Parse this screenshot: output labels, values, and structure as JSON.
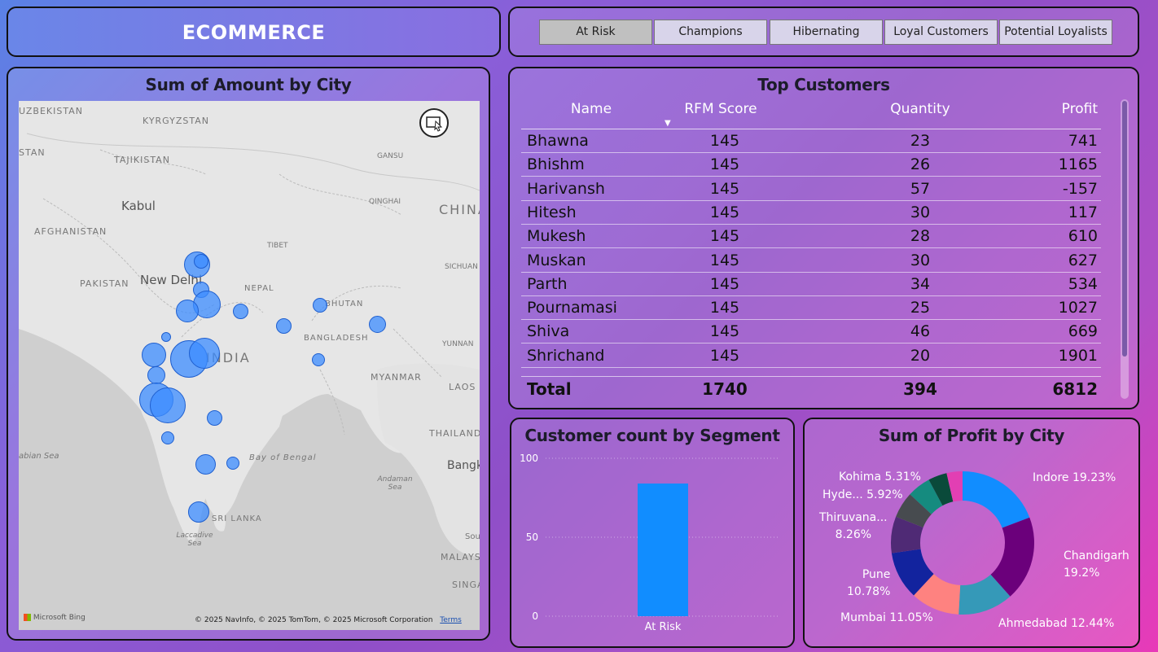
{
  "header": {
    "title": "ECOMMERCE"
  },
  "segments": [
    "At Risk",
    "Champions",
    "Hibernating",
    "Loyal Customers",
    "Potential Loyalists"
  ],
  "selected_segment": "At Risk",
  "map": {
    "title": "Sum of Amount by City",
    "labels": [
      "UZBEKISTAN",
      "KYRGYZSTAN",
      "STAN",
      "TAJIKISTAN",
      "GANSU",
      "Kabul",
      "AFGHANISTAN",
      "QINGHAI",
      "CHINA",
      "TIBET",
      "SICHUAN",
      "PAKISTAN",
      "New Delhi",
      "NEPAL",
      "BHUTAN",
      "BANGLADESH",
      "INDIA",
      "YUNNAN",
      "MYANMAR",
      "LAOS",
      "THAILAND",
      "abian Sea",
      "Bay of Bengal",
      "Bangk",
      "Andaman Sea",
      "SRI LANKA",
      "Laccadive Sea",
      "MALAYS",
      "SINGA",
      "Sou"
    ],
    "attribution": "© 2025 NavInfo, © 2025 TomTom, © 2025 Microsoft Corporation",
    "terms": "Terms",
    "bing": "Microsoft Bing"
  },
  "table": {
    "title": "Top Customers",
    "headers": {
      "name": "Name",
      "rfm": "RFM Score",
      "qty": "Quantity",
      "profit": "Profit"
    },
    "rows": [
      {
        "name": "Bhawna",
        "rfm": "145",
        "qty": "23",
        "profit": "741"
      },
      {
        "name": "Bhishm",
        "rfm": "145",
        "qty": "26",
        "profit": "1165"
      },
      {
        "name": "Harivansh",
        "rfm": "145",
        "qty": "57",
        "profit": "-157"
      },
      {
        "name": "Hitesh",
        "rfm": "145",
        "qty": "30",
        "profit": "117"
      },
      {
        "name": "Mukesh",
        "rfm": "145",
        "qty": "28",
        "profit": "610"
      },
      {
        "name": "Muskan",
        "rfm": "145",
        "qty": "30",
        "profit": "627"
      },
      {
        "name": "Parth",
        "rfm": "145",
        "qty": "34",
        "profit": "534"
      },
      {
        "name": "Pournamasi",
        "rfm": "145",
        "qty": "25",
        "profit": "1027"
      },
      {
        "name": "Shiva",
        "rfm": "145",
        "qty": "46",
        "profit": "669"
      },
      {
        "name": "Shrichand",
        "rfm": "145",
        "qty": "20",
        "profit": "1901"
      }
    ],
    "total": {
      "name": "Total",
      "rfm": "1740",
      "qty": "394",
      "profit": "6812"
    }
  },
  "chart_data": [
    {
      "type": "bar",
      "title": "Customer count by Segment",
      "categories": [
        "At Risk"
      ],
      "values": [
        84
      ],
      "ylim": [
        0,
        100
      ],
      "yticks": [
        "0",
        "50",
        "100"
      ],
      "color": "#118dff"
    },
    {
      "type": "pie",
      "title": "Sum of Profit by City",
      "donut": true,
      "slices": [
        {
          "label": "Indore",
          "value": 19.23,
          "text": "Indore 19.23%",
          "color": "#118dff"
        },
        {
          "label": "Chandigarh",
          "value": 19.2,
          "text": "Chandigarh\n19.2%",
          "color": "#6b007b"
        },
        {
          "label": "Ahmedabad",
          "value": 12.44,
          "text": "Ahmedabad 12.44%",
          "color": "#3599b8"
        },
        {
          "label": "Mumbai",
          "value": 11.05,
          "text": "Mumbai 11.05%",
          "color": "#fe8280"
        },
        {
          "label": "Pune",
          "value": 10.78,
          "text": "Pune\n10.78%",
          "color": "#12239e"
        },
        {
          "label": "Thiruvana...",
          "value": 8.26,
          "text": "Thiruvana...\n8.26%",
          "color": "#4f2a75"
        },
        {
          "label": "Hyde...",
          "value": 5.92,
          "text": "Hyde... 5.92%",
          "color": "#474b4f"
        },
        {
          "label": "Kohima",
          "value": 5.31,
          "text": "Kohima 5.31%",
          "color": "#158b7f"
        },
        {
          "label": "",
          "value": 4.23,
          "text": "",
          "color": "#0a4a3a"
        },
        {
          "label": "",
          "value": 3.58,
          "text": "",
          "color": "#e23fb3"
        }
      ]
    }
  ]
}
